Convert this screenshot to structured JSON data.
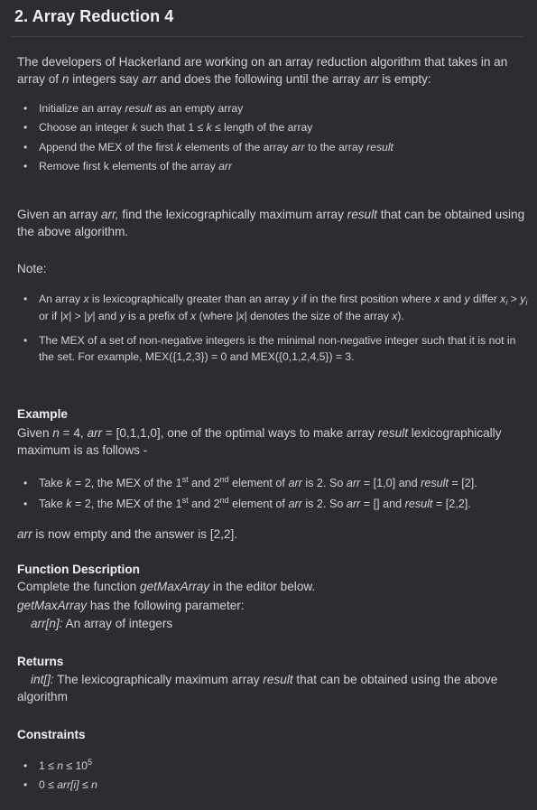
{
  "title": "2. Array Reduction 4",
  "intro": {
    "t1": "The developers of Hackerland are working on an array reduction algorithm that takes in an array of ",
    "n": "n",
    "t2": " integers say ",
    "arr1": "arr",
    "t3": " and does the following until the array ",
    "arr2": "arr",
    "t4": " is empty:"
  },
  "steps": [
    {
      "a": "Initialize an array ",
      "b": "result",
      "c": " as an empty array",
      "d": "",
      "e": ""
    },
    {
      "a": "Choose an integer ",
      "b": "k",
      "c": " such that  1 ≤ ",
      "d": "k",
      "e": " ≤ length of the array"
    },
    {
      "a": "Append the MEX of the first ",
      "b": "k",
      "c": " elements of the array ",
      "d": "arr",
      "e": " to the array ",
      "f": "result"
    },
    {
      "a": "Remove first k elements of the array ",
      "b": "arr",
      "c": "",
      "d": "",
      "e": ""
    }
  ],
  "given": {
    "t1": "Given an array ",
    "arr": "arr,",
    "t2": " find the lexicographically maximum array ",
    "result": "result",
    "t3": " that can be obtained using the above algorithm."
  },
  "note_label": "Note:",
  "notes": {
    "n1": {
      "t1": "An array ",
      "x1": "x",
      "t2": " is lexicographically greater than an array ",
      "y1": "y",
      "t3": " if in the first position where ",
      "x2": "x",
      "t4": " and ",
      "y2": "y",
      "t5": " differ ",
      "xi": "x",
      "i1": "i",
      "t6": " > ",
      "yi": "y",
      "i2": "i",
      "t7": " or if ",
      "absx": "|x|",
      "t8": " > ",
      "absy": "|y|",
      "t9": " and ",
      "y3": "y",
      "t10": " is a prefix of ",
      "x3": "x",
      "t11": " (where ",
      "absx2": "|x|",
      "t12": " denotes the size of the array ",
      "x4": "x",
      "t13": ")."
    },
    "n2": "The MEX of a set of non-negative integers is the minimal non-negative integer such that it is not in the set. For example, MEX({1,2,3}) = 0 and MEX({0,1,2,4,5}) = 3."
  },
  "example": {
    "heading": "Example",
    "t1": "Given ",
    "n": "n",
    "t2": " = 4, ",
    "arr": "arr",
    "t3": " = [0,1,1,0], one of the optimal ways to make array ",
    "result": "result",
    "t4": " lexicographically maximum is as follows -",
    "steps": [
      {
        "a": "Take ",
        "k": "k",
        "b": " = 2, the MEX of the 1",
        "s1": "st",
        "c": " and 2",
        "s2": "nd",
        "d": " element of ",
        "arr": "arr",
        "e": " is 2. So ",
        "arr2": "arr",
        "f": " = [1,0] and ",
        "result": "result",
        "g": " = [2]."
      },
      {
        "a": "Take ",
        "k": "k",
        "b": " = 2, the MEX of the 1",
        "s1": "st",
        "c": " and 2",
        "s2": "nd",
        "d": " element of ",
        "arr": "arr",
        "e": " is 2. So ",
        "arr2": "arr",
        "f": " = [] and ",
        "result": "result",
        "g": " = [2,2]."
      }
    ],
    "conclusion_arr": "arr",
    "conclusion": " is now empty and the answer is [2,2]."
  },
  "function_description": {
    "heading": "Function Description",
    "t1": "Complete the function ",
    "fn": "getMaxArray",
    "t2": " in the editor below.",
    "fn2": "getMaxArray",
    "t3": " has the following parameter:",
    "param": "arr[n]:",
    "param_desc": "  An array of integers"
  },
  "returns": {
    "heading": "Returns",
    "type": "int[]:",
    "t1": " The lexicographically maximum array ",
    "result": "result",
    "t2": " that can be obtained using the above algorithm"
  },
  "constraints": {
    "heading": "Constraints",
    "c1": {
      "a": "1 ≤ ",
      "n": "n",
      "b": " ≤ 10",
      "exp": "5"
    },
    "c2": {
      "a": "0 ≤ ",
      "arr": "arr[i]",
      "b": " ≤ ",
      "n": "n"
    }
  }
}
